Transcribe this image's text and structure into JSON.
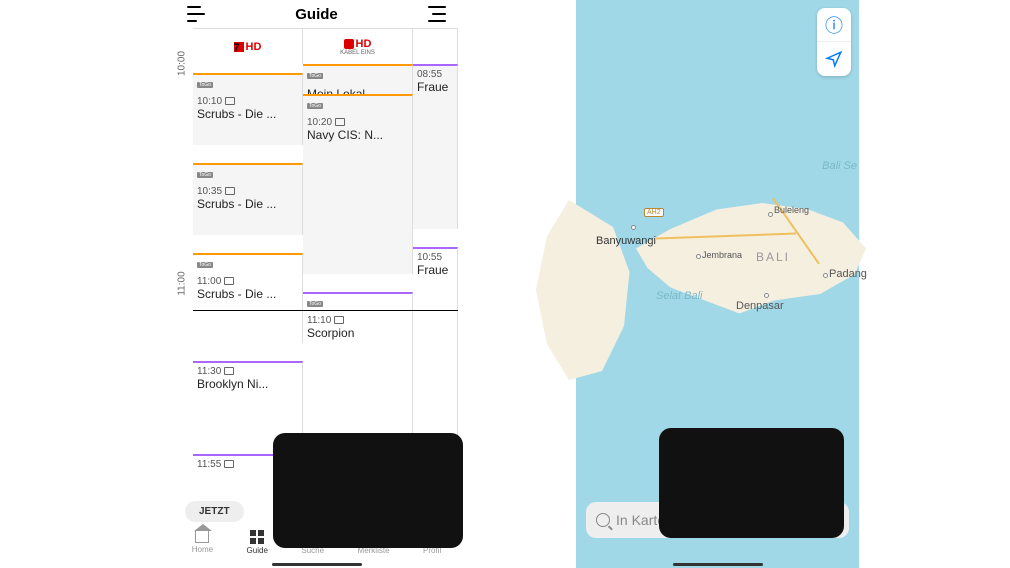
{
  "left": {
    "header": {
      "title": "Guide"
    },
    "times": [
      "10:00",
      "11:00"
    ],
    "channels": [
      {
        "logo": "7",
        "hd": "HD"
      },
      {
        "logo": "K",
        "hd": "HD",
        "sub": "KABEL EINS"
      }
    ],
    "programs": {
      "c1": [
        {
          "time": "10:10",
          "title": "Scrubs - Die ...",
          "badge": "ToGo"
        },
        {
          "time": "10:35",
          "title": "Scrubs - Die ...",
          "badge": "ToGo"
        },
        {
          "time": "11:00",
          "title": "Scrubs - Die ...",
          "badge": "ToGo"
        },
        {
          "time": "11:30",
          "title": "Brooklyn Ni...",
          "badge": ""
        },
        {
          "time": "11:55",
          "title": "",
          "badge": ""
        }
      ],
      "c2": [
        {
          "time": "",
          "title": "Mein Lokal, ...",
          "badge": "ToGo"
        },
        {
          "time": "10:20",
          "title": "Navy CIS: N...",
          "badge": "ToGo"
        },
        {
          "time": "11:10",
          "title": "Scorpion",
          "badge": "ToGo"
        }
      ],
      "c3": [
        {
          "time": "08:55",
          "title": "Fraue",
          "badge": ""
        },
        {
          "time": "10:55",
          "title": "Fraue",
          "badge": ""
        }
      ]
    },
    "jetzt": "JETZT",
    "tabs": [
      {
        "label": "Home"
      },
      {
        "label": "Guide"
      },
      {
        "label": "Suche"
      },
      {
        "label": "Merkliste"
      },
      {
        "label": "Profil"
      }
    ]
  },
  "right": {
    "cities": {
      "banyuwangi": "Banyuwangi",
      "buleleng": "Buleleng",
      "jembrana": "Jembrana",
      "denpasar": "Denpasar",
      "padang": "Padang"
    },
    "regions": {
      "bali": "BALI"
    },
    "sea": {
      "selat": "Selat Bali",
      "east": "Bali Se"
    },
    "roads": {
      "ah2": "AH2"
    },
    "search_placeholder": "In Karten"
  }
}
